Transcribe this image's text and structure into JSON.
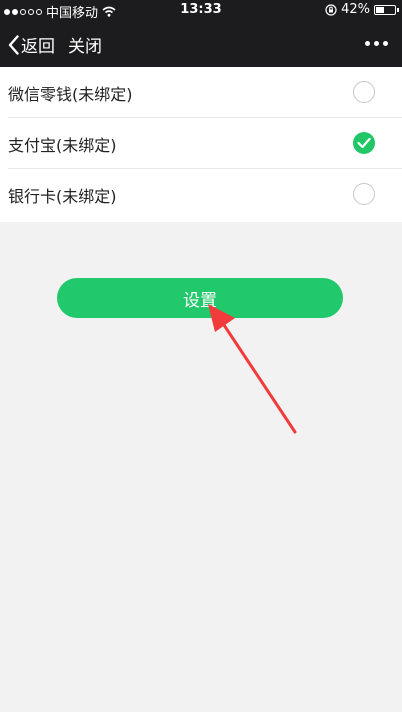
{
  "status_bar": {
    "carrier": "中国移动",
    "time": "13:33",
    "battery": "42%",
    "battery_level": 0.42
  },
  "navbar": {
    "back_label": "返回",
    "close_label": "关闭"
  },
  "options": [
    {
      "label": "微信零钱(未绑定)",
      "checked": false
    },
    {
      "label": "支付宝(未绑定)",
      "checked": true
    },
    {
      "label": "银行卡(未绑定)",
      "checked": false
    }
  ],
  "set_button": {
    "label": "设置"
  },
  "colors": {
    "accent": "#22c96c",
    "nav_background": "#1c1c1e",
    "annotation_arrow": "#f23b3b"
  }
}
